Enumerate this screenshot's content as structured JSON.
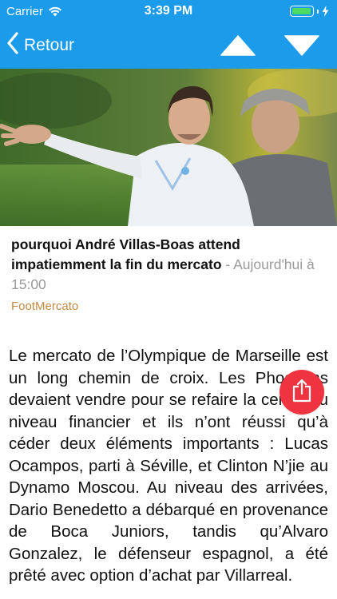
{
  "status_bar": {
    "carrier": "Carrier",
    "time": "3:39 PM",
    "battery_level": 1.0
  },
  "nav": {
    "back_label": "Retour",
    "icons": [
      "chevron-left-icon",
      "arrow-up-icon",
      "arrow-down-icon"
    ],
    "accent_color": "#1b9bea"
  },
  "article": {
    "title": "pourquoi André Villas-Boas attend impatiemment la fin du mercato",
    "separator": " - ",
    "date": "Aujourd'hui à 15:00",
    "source": "FootMercato",
    "body": "Le mercato de l’Olympique de Marseille est un long chemin de croix. Les Phocéens devaient vendre pour se refaire la cerise au niveau financier et ils n’ont réussi qu’à céder deux éléments importants : Lucas Ocampos, parti à Séville, et Clinton N’jie au Dynamo Moscou. Au niveau des arrivées, Dario Benedetto a débarqué en provenance de Boca Juniors, tandis qu’Alvaro Gonzalez, le défenseur espagnol, a été prêté avec option d’achat par Villarreal."
  },
  "share": {
    "icon": "share-icon",
    "color": "#ef3340"
  }
}
